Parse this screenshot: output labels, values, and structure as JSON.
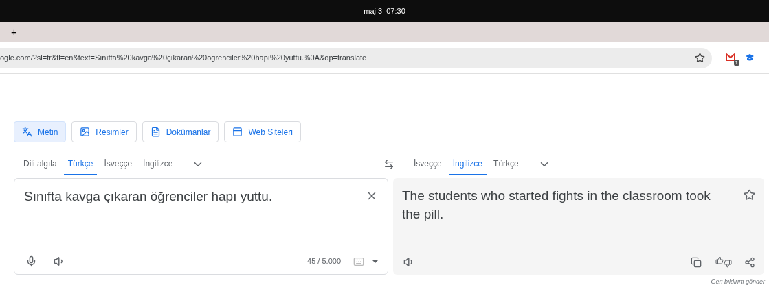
{
  "system_bar": {
    "clock": "maj 3  07:30"
  },
  "tab_strip": {
    "new_tab": "+"
  },
  "address_bar": {
    "url": "ogle.com/?sl=tr&tl=en&text=Sınıfta%20kavga%20çıkaran%20öğrenciler%20hapı%20yuttu.%0A&op=translate",
    "badge": "1"
  },
  "modes": [
    {
      "kind": "text",
      "label": "Metin",
      "selected": true
    },
    {
      "kind": "images",
      "label": "Resimler",
      "selected": false
    },
    {
      "kind": "documents",
      "label": "Dokümanlar",
      "selected": false
    },
    {
      "kind": "websites",
      "label": "Web Siteleri",
      "selected": false
    }
  ],
  "source_languages": [
    {
      "label": "Dili algıla",
      "selected": false
    },
    {
      "label": "Türkçe",
      "selected": true
    },
    {
      "label": "İsveççe",
      "selected": false
    },
    {
      "label": "İngilizce",
      "selected": false
    }
  ],
  "target_languages": [
    {
      "label": "İsveççe",
      "selected": false
    },
    {
      "label": "İngilizce",
      "selected": true
    },
    {
      "label": "Türkçe",
      "selected": false
    }
  ],
  "source": {
    "text": "Sınıfta kavga çıkaran öğrenciler hapı yuttu.",
    "count": "45 / 5.000"
  },
  "target": {
    "text": "The students who started fights in the classroom took the pill."
  },
  "feedback": "Geri bildirim gönder"
}
